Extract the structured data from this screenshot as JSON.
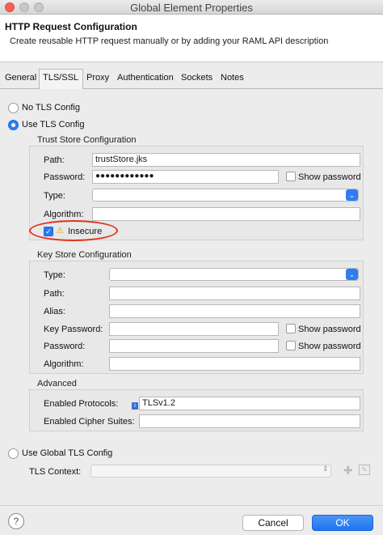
{
  "window": {
    "title": "Global Element Properties"
  },
  "header": {
    "title": "HTTP Request Configuration",
    "subtitle": "Create reusable HTTP request manually or by adding your RAML API description"
  },
  "tabs": [
    {
      "label": "General"
    },
    {
      "label": "TLS/SSL",
      "active": true
    },
    {
      "label": "Proxy"
    },
    {
      "label": "Authentication"
    },
    {
      "label": "Sockets"
    },
    {
      "label": "Notes"
    }
  ],
  "tls": {
    "no_tls_label": "No TLS Config",
    "use_tls_label": "Use TLS Config",
    "use_global_label": "Use Global TLS Config",
    "selected": "use_tls"
  },
  "trust_store": {
    "title": "Trust Store Configuration",
    "path_label": "Path:",
    "path_value": "trustStore.jks",
    "password_label": "Password:",
    "password_value": "●●●●●●●●●●●●",
    "show_password_label": "Show password",
    "type_label": "Type:",
    "type_value": "",
    "algorithm_label": "Algorithm:",
    "algorithm_value": "",
    "insecure_label": "Insecure",
    "insecure_checked": true
  },
  "key_store": {
    "title": "Key Store Configuration",
    "type_label": "Type:",
    "path_label": "Path:",
    "alias_label": "Alias:",
    "key_password_label": "Key Password:",
    "password_label": "Password:",
    "show_password_label": "Show password",
    "algorithm_label": "Algorithm:"
  },
  "advanced": {
    "title": "Advanced",
    "protocols_label": "Enabled Protocols:",
    "protocols_value": "TLSv1.2",
    "ciphers_label": "Enabled Cipher Suites:",
    "ciphers_value": ""
  },
  "global": {
    "context_label": "TLS Context:",
    "context_value": ""
  },
  "footer": {
    "cancel_label": "Cancel",
    "ok_label": "OK",
    "help_symbol": "?"
  },
  "colors": {
    "accent": "#2b7cf0",
    "highlight": "#e1321b"
  }
}
